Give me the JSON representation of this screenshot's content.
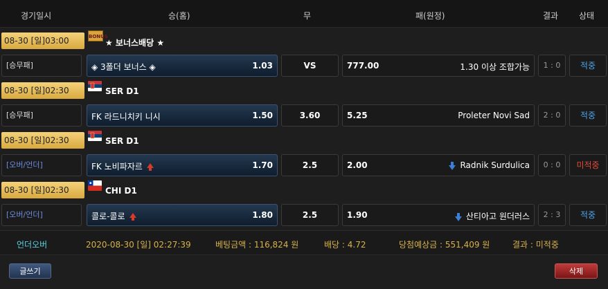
{
  "header": {
    "col_datetime": "경기일시",
    "col_home": "승(홈)",
    "col_draw": "무",
    "col_away": "패(원정)",
    "col_result": "결과",
    "col_status": "상태"
  },
  "games": [
    {
      "datetime": "08-30 [일]03:00",
      "league": "★ 보너스배당 ★",
      "league_icon": "bonus-logo-icon",
      "logo_text": "BONUS",
      "bet_type": "[승무패]",
      "home_name": "◈ 3폴더 보너스 ◈",
      "home_odd": "1.03",
      "draw": "VS",
      "away_odd": "777.00",
      "away_name": "1.30 이상 조합가능",
      "score": "1 : 0",
      "status": "적중"
    },
    {
      "datetime": "08-30 [일]02:30",
      "league": "SER D1",
      "league_icon": "serbia-flag-icon",
      "bet_type": "[승무패]",
      "home_name": "FK 라드니치키 니시",
      "home_odd": "1.50",
      "draw": "3.60",
      "away_odd": "5.25",
      "away_name": "Proleter Novi Sad",
      "score": "2 : 0",
      "status": "적중"
    },
    {
      "datetime": "08-30 [일]02:30",
      "league": "SER D1",
      "league_icon": "serbia-flag-icon",
      "bet_type": "[오버/언더]",
      "home_name": "FK 노비파자르",
      "home_odd": "1.70",
      "draw": "2.5",
      "away_odd": "2.00",
      "away_name": "Radnik Surdulica",
      "score": "0 : 0",
      "status": "미적중"
    },
    {
      "datetime": "08-30 [일]02:30",
      "league": "CHI D1",
      "league_icon": "chile-flag-icon",
      "bet_type": "[오버/언더]",
      "home_name": "콜로-콜로",
      "home_odd": "1.80",
      "draw": "2.5",
      "away_odd": "1.90",
      "away_name": "산티아고 원더러스",
      "score": "2 : 3",
      "status": "적중"
    }
  ],
  "summary": {
    "type": "언더오버",
    "datetime": "2020-08-30 [일] 02:27:39",
    "bet_amount": "베팅금액 : 116,824 원",
    "odds": "배당 : 4.72",
    "expected": "당첨예상금 : 551,409 원",
    "result": "결과 : 미적중"
  },
  "buttons": {
    "write": "글쓰기",
    "delete": "삭제"
  },
  "colors": {
    "accent_gold": "#d8a93f",
    "hit": "#4ea3e8",
    "miss": "#e24a3a"
  }
}
